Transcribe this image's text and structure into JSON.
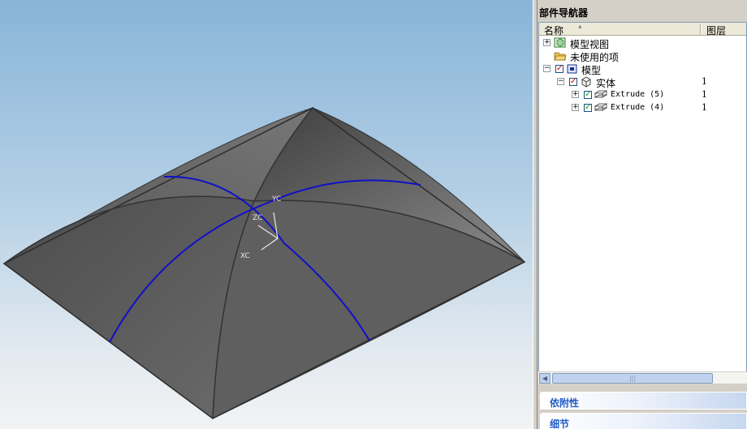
{
  "viewport": {
    "axis_labels": {
      "yc": "YC",
      "zc": "ZC",
      "xc": "XC"
    },
    "colors": {
      "surface": "#5a5a5a",
      "edge_curves": "#1010c8",
      "background_top": "#88b4d8",
      "background_bottom": "#f2f3f4"
    }
  },
  "navigator": {
    "title": "部件导航器",
    "columns": {
      "name": "名称",
      "layer": "图层"
    },
    "items": [
      {
        "label": "模型视图",
        "icon": "model-views-icon",
        "expander": "+"
      },
      {
        "label": "未使用的项",
        "icon": "open-folder-icon"
      },
      {
        "label": "模型",
        "icon": "model-icon",
        "expander": "−",
        "checked": true
      },
      {
        "label": "实体",
        "icon": "solid-body-icon",
        "expander": "−",
        "checked": true,
        "layer": "1"
      },
      {
        "label": "Extrude (5)",
        "icon": "extrude-icon",
        "expander": "+",
        "checked": true,
        "layer": "1"
      },
      {
        "label": "Extrude (4)",
        "icon": "extrude-icon",
        "expander": "+",
        "checked": true,
        "layer": "1"
      }
    ],
    "sections": {
      "dependencies": "依附性",
      "details": "细节"
    }
  }
}
